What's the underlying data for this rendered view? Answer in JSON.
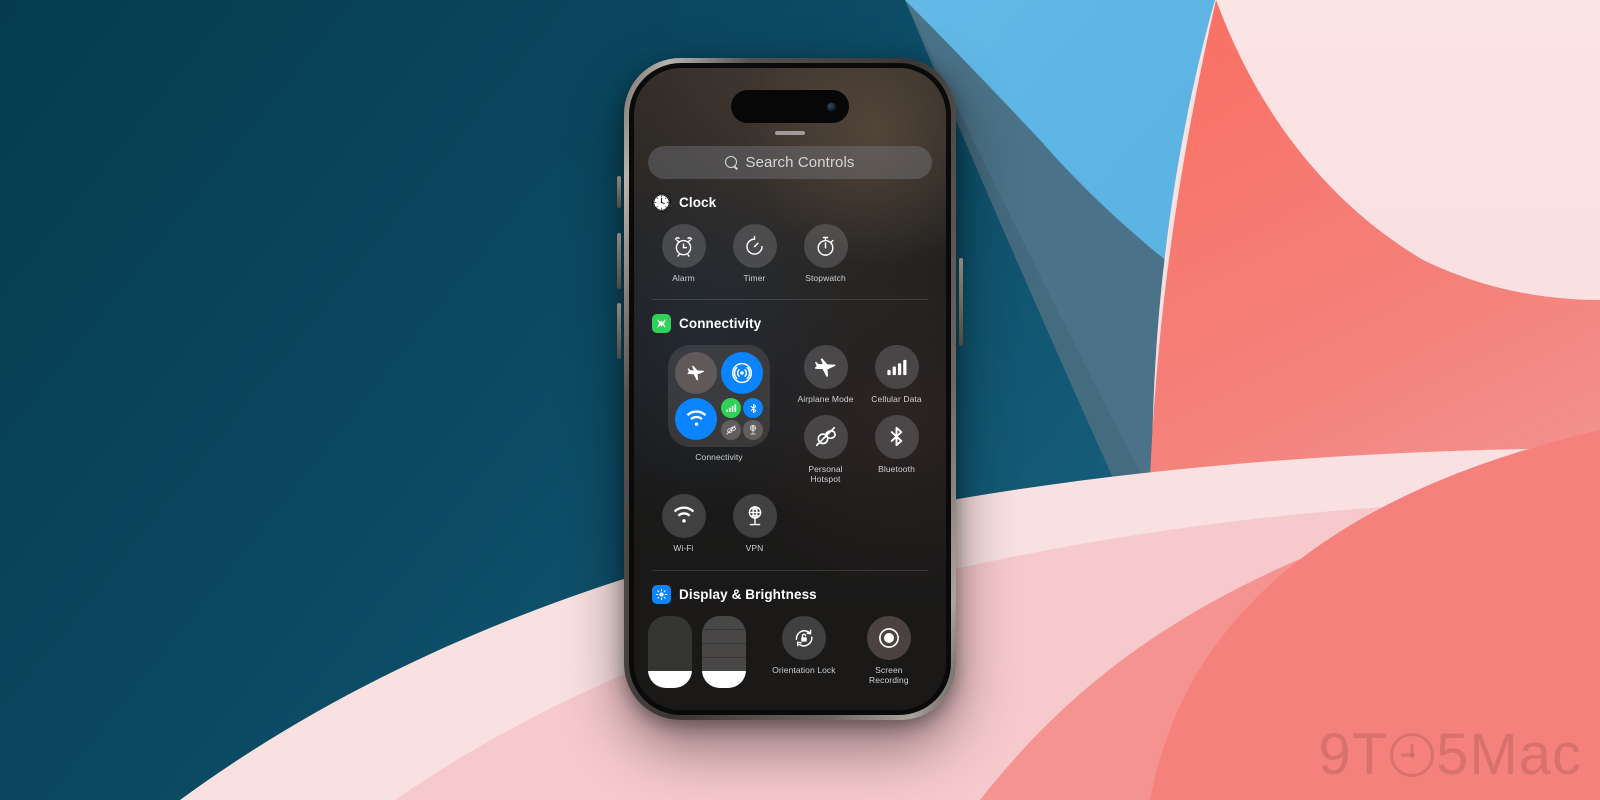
{
  "background": {
    "colors": {
      "teal_dark": "#063d52",
      "teal_mid": "#0f5b78",
      "blue_light": "#5cb4e2",
      "blue_slate": "#4b6d80",
      "coral": "#f4776f",
      "pink_light": "#f7cfd2",
      "pink_pale": "#fbe2e2",
      "cream_pink": "#fae0e0"
    }
  },
  "watermark": {
    "part1": "9T",
    "part2": "5Mac"
  },
  "device": {
    "name": "iPhone",
    "frame_color": "#5d5855",
    "screen_bg": "#201f1e"
  },
  "control_center": {
    "grabber": "drag-handle",
    "search": {
      "placeholder": "Search Controls",
      "value": "",
      "icon": "search-icon"
    },
    "sections": [
      {
        "id": "clock",
        "title": "Clock",
        "badge_icon": "clock-app-icon",
        "badge_color": "#ffffff",
        "controls": [
          {
            "label": "Alarm",
            "icon": "alarm-icon",
            "state": "off"
          },
          {
            "label": "Timer",
            "icon": "timer-icon",
            "state": "off"
          },
          {
            "label": "Stopwatch",
            "icon": "stopwatch-icon",
            "state": "off"
          }
        ]
      },
      {
        "id": "connectivity",
        "title": "Connectivity",
        "badge_icon": "connectivity-antenna-icon",
        "badge_color": "#30d158",
        "group_module": {
          "label": "Connectivity",
          "tiles": [
            {
              "name": "airplane-mode",
              "icon": "airplane-icon",
              "state": "off",
              "color": "#968280"
            },
            {
              "name": "airdrop",
              "icon": "airdrop-icon",
              "state": "on",
              "color": "#0a84ff"
            },
            {
              "name": "wifi",
              "icon": "wifi-icon",
              "state": "on",
              "color": "#0a84ff"
            },
            {
              "name": "cellular-data",
              "icon": "cellular-bars-icon",
              "state": "on",
              "color": "#30d158"
            },
            {
              "name": "bluetooth",
              "icon": "bluetooth-icon",
              "state": "on",
              "color": "#0a84ff"
            },
            {
              "name": "personal-hotspot",
              "icon": "hotspot-off-icon",
              "state": "off",
              "color": "#8c8884"
            },
            {
              "name": "vpn",
              "icon": "vpn-icon",
              "state": "off",
              "color": "#8c8884"
            }
          ]
        },
        "controls": [
          {
            "label": "Airplane Mode",
            "icon": "airplane-icon",
            "state": "off"
          },
          {
            "label": "Cellular Data",
            "icon": "cellular-bars-icon",
            "state": "off"
          },
          {
            "label": "Personal Hotspot",
            "icon": "hotspot-off-icon",
            "state": "off"
          },
          {
            "label": "Bluetooth",
            "icon": "bluetooth-icon",
            "state": "off"
          },
          {
            "label": "Wi-Fi",
            "icon": "wifi-icon",
            "state": "off"
          },
          {
            "label": "VPN",
            "icon": "vpn-icon",
            "state": "off"
          }
        ]
      },
      {
        "id": "display-brightness",
        "title": "Display & Brightness",
        "badge_icon": "brightness-sun-icon",
        "badge_color": "#0a84ff",
        "sliders": [
          {
            "name": "brightness-slider",
            "fill_percent": 24,
            "style": "plain"
          },
          {
            "name": "volume-slider",
            "fill_percent": 24,
            "style": "striped"
          }
        ],
        "controls": [
          {
            "label": "Orientation Lock",
            "icon": "rotation-lock-icon",
            "state": "off"
          },
          {
            "label": "Screen Recording",
            "icon": "screen-record-icon",
            "state": "off"
          }
        ]
      }
    ]
  }
}
